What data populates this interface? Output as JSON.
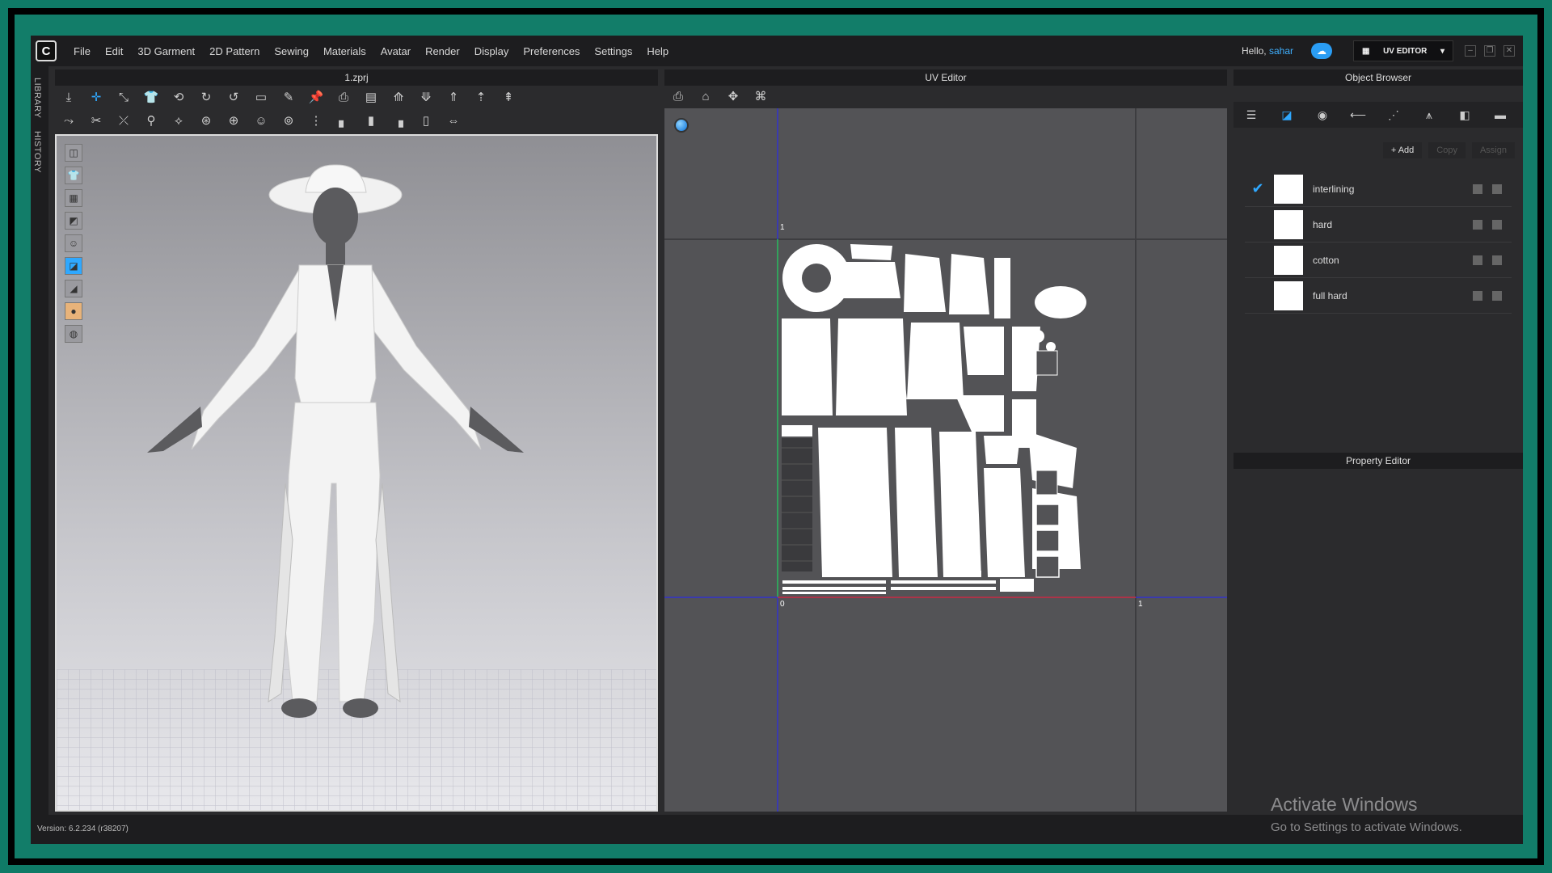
{
  "app": {
    "logo_letter": "C",
    "version": "Version: 6.2.234 (r38207)"
  },
  "menu": [
    "File",
    "Edit",
    "3D Garment",
    "2D Pattern",
    "Sewing",
    "Materials",
    "Avatar",
    "Render",
    "Display",
    "Preferences",
    "Settings",
    "Help"
  ],
  "user": {
    "greeting": "Hello,",
    "name": "sahar"
  },
  "mode_button": {
    "label": "UV EDITOR",
    "icon": "grid-icon"
  },
  "sidebar_tabs": [
    "LIBRARY",
    "HISTORY"
  ],
  "viewport3d": {
    "title": "1.zprj"
  },
  "uv_editor": {
    "title": "UV Editor",
    "axis_labels": {
      "top_left": "1",
      "bottom_left": "0",
      "bottom_right": "1"
    }
  },
  "object_browser": {
    "title": "Object Browser",
    "actions": {
      "add": "Add",
      "copy": "Copy",
      "assign": "Assign"
    },
    "materials": [
      {
        "name": "interlining",
        "checked": true
      },
      {
        "name": "hard",
        "checked": false
      },
      {
        "name": "cotton",
        "checked": false
      },
      {
        "name": "full hard",
        "checked": false
      }
    ]
  },
  "property_editor": {
    "title": "Property Editor"
  },
  "watermark": {
    "line1": "Activate Windows",
    "line2": "Go to Settings to activate Windows."
  },
  "colors": {
    "accent": "#2fa8ff",
    "teal_frame": "#127d69",
    "panel_bg": "#2b2b2d",
    "uv_bg": "#535356"
  }
}
